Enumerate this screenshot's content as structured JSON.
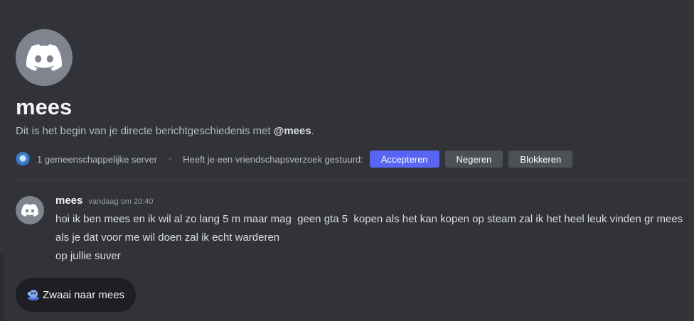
{
  "header": {
    "username": "mees",
    "intro_prefix": "Dit is het begin van je directe berichtgeschiedenis met ",
    "intro_mention": "@mees",
    "intro_suffix": ".",
    "mutual_servers": "1 gemeenschappelijke server",
    "request_text": "Heeft je een vriendschapsverzoek gestuurd:",
    "accept_label": "Accepteren",
    "ignore_label": "Negeren",
    "block_label": "Blokkeren"
  },
  "message": {
    "author": "mees",
    "timestamp": "vandaag om 20:40",
    "lines": [
      "hoi ik ben mees en ik wil al zo lang 5 m maar mag  geen gta 5  kopen als het kan kopen op steam zal ik het heel leuk vinden gr mees",
      "als je dat voor me wil doen zal ik echt warderen",
      "op jullie suver"
    ]
  },
  "wave_button": {
    "label": "Zwaai naar mees"
  },
  "colors": {
    "background": "#313338",
    "accent": "#5865f2",
    "secondary_button": "#4e5058",
    "avatar": "#80848e"
  },
  "icons": {
    "avatar": "discord-logo-icon",
    "mutual": "server-icon",
    "wave": "wave-sticker-icon"
  }
}
